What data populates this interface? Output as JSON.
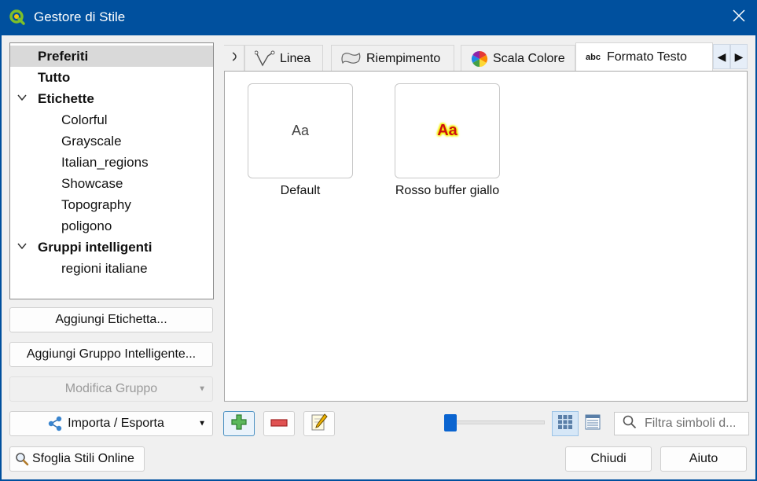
{
  "window": {
    "title": "Gestore di Stile"
  },
  "tree": {
    "items": [
      {
        "label": "Preferiti",
        "level": 0,
        "bold": true,
        "selected": true,
        "expandable": false
      },
      {
        "label": "Tutto",
        "level": 0,
        "bold": true,
        "selected": false,
        "expandable": false
      },
      {
        "label": "Etichette",
        "level": 0,
        "bold": true,
        "selected": false,
        "expandable": true
      },
      {
        "label": "Colorful",
        "level": 1,
        "bold": false
      },
      {
        "label": "Grayscale",
        "level": 1,
        "bold": false
      },
      {
        "label": "Italian_regions",
        "level": 1,
        "bold": false
      },
      {
        "label": "Showcase",
        "level": 1,
        "bold": false
      },
      {
        "label": "Topography",
        "level": 1,
        "bold": false
      },
      {
        "label": "poligono",
        "level": 1,
        "bold": false
      },
      {
        "label": "Gruppi intelligenti",
        "level": 0,
        "bold": true,
        "selected": false,
        "expandable": true
      },
      {
        "label": "regioni italiane",
        "level": 1,
        "bold": false
      }
    ]
  },
  "left_buttons": {
    "add_tag": "Aggiungi Etichetta...",
    "add_smart_group": "Aggiungi Gruppo Intelligente...",
    "modify_group": "Modifica Gruppo",
    "import_export": "Importa / Esporta",
    "browse_online": "Sfoglia Stili Online"
  },
  "tabs": {
    "items": [
      {
        "label": "Linea",
        "icon": "line-icon"
      },
      {
        "label": "Riempimento",
        "icon": "fill-icon"
      },
      {
        "label": "Scala Colore",
        "icon": "color-ramp-icon"
      },
      {
        "label": "Formato Testo",
        "icon": "text-format-icon",
        "active": true
      }
    ],
    "text_icon_label": "abc"
  },
  "symbols": [
    {
      "name": "Default",
      "preview_text": "Aa",
      "style": "plain"
    },
    {
      "name": "Rosso buffer giallo",
      "preview_text": "Aa",
      "style": "red-yellow-buffer"
    }
  ],
  "toolbar": {
    "search_placeholder": "Filtra simboli d...",
    "zoom_level": 0
  },
  "dialog_buttons": {
    "close": "Chiudi",
    "help": "Aiuto"
  },
  "colors": {
    "titlebar": "#00509e",
    "accent": "#0a64d0",
    "buffer_red": "#cc1010",
    "buffer_yellow": "#f2f200"
  }
}
